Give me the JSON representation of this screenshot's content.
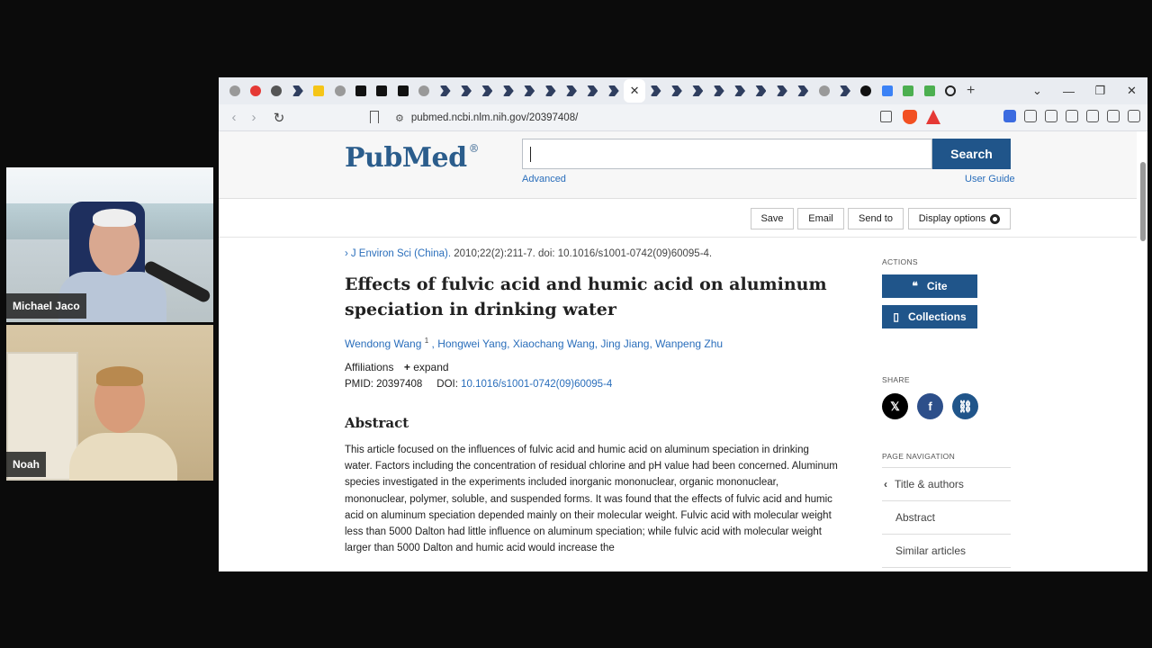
{
  "participants": [
    {
      "name": "Michael Jaco"
    },
    {
      "name": "Noah"
    }
  ],
  "browser": {
    "url": "pubmed.ncbi.nlm.nih.gov/20397408/",
    "active_tab_close": "✕",
    "new_tab": "+"
  },
  "pubmed": {
    "logo": "PubMed",
    "logo_mark": "®",
    "search_placeholder": "",
    "search_button": "Search",
    "advanced": "Advanced",
    "user_guide": "User Guide",
    "toolbar": {
      "save": "Save",
      "email": "Email",
      "send_to": "Send to",
      "display_options": "Display options"
    },
    "article": {
      "journal": "J Environ Sci (China).",
      "citation_rest": " 2010;22(2):211-7. doi: 10.1016/s1001-0742(09)60095-4.",
      "title": "Effects of fulvic acid and humic acid on aluminum speciation in drinking water",
      "first_author": "Wendong Wang",
      "first_author_sup": "1",
      "other_authors": ", Hongwei Yang, Xiaochang Wang, Jing Jiang, Wanpeng Zhu",
      "affiliations": "Affiliations",
      "expand": "expand",
      "pmid": "PMID: 20397408",
      "doi_label": "DOI:",
      "doi": "10.1016/s1001-0742(09)60095-4",
      "abstract_heading": "Abstract",
      "abstract_text": "This article focused on the influences of fulvic acid and humic acid on aluminum speciation in drinking water. Factors including the concentration of residual chlorine and pH value had been concerned. Aluminum species investigated in the experiments included inorganic mononuclear, organic mononuclear, mononuclear, polymer, soluble, and suspended forms. It was found that the effects of fulvic acid and humic acid on aluminum speciation depended mainly on their molecular weight. Fulvic acid with molecular weight less than 5000 Dalton had little influence on aluminum speciation; while fulvic acid with molecular weight larger than 5000 Dalton and humic acid would increase the"
    },
    "sidebar": {
      "actions_heading": "ACTIONS",
      "cite": "Cite",
      "collections": "Collections",
      "share_heading": "SHARE",
      "page_nav_heading": "PAGE NAVIGATION",
      "nav_items": [
        "Title & authors",
        "Abstract",
        "Similar articles"
      ]
    }
  }
}
